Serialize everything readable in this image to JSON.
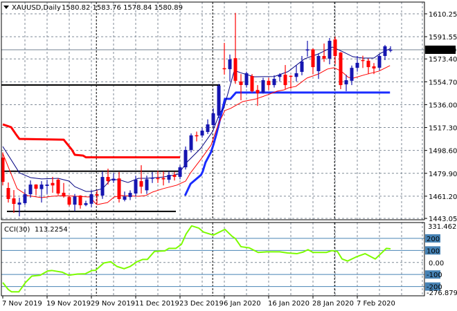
{
  "header": {
    "symbol_timeframe": "XAUUSD,Daily",
    "ohlc_text": "1580.82 1583.76 1578.84 1580.89",
    "menu_icon": "triangle-down-icon"
  },
  "colors": {
    "bull": "#1515b0",
    "bear": "#ff0000",
    "ma_fast": "#000080",
    "ma_slow": "#ff0000",
    "upper_step": "#ff0000",
    "lower_step": "#1a2cff",
    "levels": "#000000",
    "cci": "#7cfc00",
    "cci_levels": "#4682b4",
    "grid": "#7f8a96",
    "price_line": "#708090"
  },
  "chart_data": [
    {
      "type": "candlestick",
      "title": "XAUUSD,Daily",
      "ylim": [
        1443.05,
        1610.25
      ],
      "y_ticks": [
        "1610.25",
        "1591.55",
        "1573.40",
        "1554.70",
        "1536.00",
        "1517.30",
        "1498.60",
        "1479.90",
        "1461.20",
        "1443.05"
      ],
      "current_price": "1580.89",
      "x_labels": [
        "7 Nov 2019",
        "19 Nov 2019",
        "29 Nov 2019",
        "11 Dec 2019",
        "23 Dec 2019",
        "6 Jan 2020",
        "16 Jan 2020",
        "28 Jan 2020",
        "7 Feb 2020"
      ],
      "x_label_every_bars": 8,
      "candles_ohlc": [
        [
          1492.7,
          1497,
          1470,
          1472.9
        ],
        [
          1467.9,
          1472.4,
          1456.0,
          1458.9
        ],
        [
          1459.4,
          1466.2,
          1447.6,
          1454.9
        ],
        [
          1454.3,
          1460.0,
          1444.7,
          1456.0
        ],
        [
          1455.5,
          1466.8,
          1454,
          1462.8
        ],
        [
          1462.8,
          1474.1,
          1460.0,
          1470.7
        ],
        [
          1470.7,
          1471,
          1462,
          1467.3
        ],
        [
          1467,
          1473.5,
          1456,
          1470.7
        ],
        [
          1469.6,
          1474.6,
          1463,
          1470.7
        ],
        [
          1472,
          1477,
          1464,
          1470
        ],
        [
          1474.7,
          1476,
          1462,
          1463.4
        ],
        [
          1464,
          1472,
          1460,
          1461
        ],
        [
          1460.5,
          1461,
          1453,
          1454.3
        ],
        [
          1454.3,
          1463,
          1449,
          1461
        ],
        [
          1461.7,
          1462,
          1451,
          1453.8
        ],
        [
          1454,
          1457.5,
          1453,
          1455.5
        ],
        [
          1455,
          1466,
          1452,
          1462.8
        ],
        [
          1462.8,
          1466,
          1455,
          1461.7
        ],
        [
          1461.7,
          1481.5,
          1459,
          1476.9
        ],
        [
          1476.9,
          1483.7,
          1470.7,
          1473.5
        ],
        [
          1474,
          1480,
          1472,
          1475.5
        ],
        [
          1475.7,
          1480.9,
          1456,
          1458.9
        ],
        [
          1458.3,
          1465,
          1457,
          1461
        ],
        [
          1460.5,
          1466,
          1458,
          1463.9
        ],
        [
          1463.4,
          1478,
          1461,
          1474.7
        ],
        [
          1473.5,
          1486.5,
          1463.4,
          1469
        ],
        [
          1466,
          1478,
          1463,
          1475
        ],
        [
          1475.5,
          1481,
          1472,
          1476.3
        ],
        [
          1476,
          1482,
          1472,
          1475.5
        ],
        [
          1476,
          1481.5,
          1470,
          1475
        ],
        [
          1474.7,
          1481.5,
          1472,
          1478.6
        ],
        [
          1478.6,
          1481,
          1474,
          1477
        ],
        [
          1477,
          1486.5,
          1475,
          1484.8
        ],
        [
          1484.8,
          1501.8,
          1483,
          1499
        ],
        [
          1499,
          1512.5,
          1497,
          1510.9
        ],
        [
          1511,
          1514,
          1506,
          1510.8
        ],
        [
          1510.8,
          1517,
          1509,
          1514.8
        ],
        [
          1513.7,
          1524,
          1512,
          1519.9
        ],
        [
          1519.3,
          1533,
          1517,
          1528.9
        ],
        [
          1527,
          1553,
          1525,
          1551.5
        ],
        [
          1565.8,
          1586.5,
          1560.5,
          1565.1
        ],
        [
          1565,
          1577,
          1555,
          1573
        ],
        [
          1574,
          1611,
          1553,
          1555.5
        ],
        [
          1554.9,
          1561,
          1539.6,
          1552.1
        ],
        [
          1552,
          1563,
          1550,
          1561.7
        ],
        [
          1559.4,
          1561,
          1546,
          1547
        ],
        [
          1548,
          1552,
          1535,
          1545.3
        ],
        [
          1545.9,
          1558,
          1545,
          1556
        ],
        [
          1555.5,
          1558,
          1548,
          1552
        ],
        [
          1552,
          1560,
          1550,
          1557.1
        ],
        [
          1558.7,
          1561.6,
          1555,
          1560.5
        ],
        [
          1560.5,
          1568.4,
          1548.7,
          1552
        ],
        [
          1559.6,
          1560,
          1549,
          1559.4
        ],
        [
          1558.7,
          1568,
          1555,
          1561.7
        ],
        [
          1562.8,
          1575.8,
          1560,
          1571.3
        ],
        [
          1580.3,
          1588.2,
          1575.2,
          1581.2
        ],
        [
          1581.2,
          1582,
          1561,
          1566.7
        ],
        [
          1563.4,
          1578,
          1557,
          1575.8
        ],
        [
          1575.8,
          1586,
          1571,
          1573.6
        ],
        [
          1573.6,
          1590.5,
          1569,
          1588.2
        ],
        [
          1589.3,
          1591.6,
          1569,
          1575.8
        ],
        [
          1578.6,
          1579,
          1548.7,
          1552
        ],
        [
          1552.6,
          1560.5,
          1547,
          1556
        ],
        [
          1555.5,
          1568,
          1552,
          1566.1
        ],
        [
          1566.1,
          1575.8,
          1563,
          1570.2
        ],
        [
          1572.5,
          1576,
          1566,
          1571.9
        ],
        [
          1571.9,
          1573.6,
          1561,
          1566.7
        ],
        [
          1567.3,
          1570,
          1561,
          1565.6
        ],
        [
          1566.2,
          1577,
          1564,
          1575.8
        ],
        [
          1575.8,
          1584.8,
          1572.4,
          1583.7
        ],
        [
          1580.82,
          1583.76,
          1578.84,
          1580.89
        ]
      ],
      "overlays": {
        "ma_fast": [
          [
            0,
            1501.8
          ],
          [
            3,
            1480.3
          ],
          [
            5,
            1476.4
          ],
          [
            7,
            1475.3
          ],
          [
            10,
            1475.8
          ],
          [
            12,
            1473.5
          ],
          [
            13,
            1469
          ],
          [
            15,
            1465.1
          ],
          [
            16,
            1465.1
          ],
          [
            18,
            1467.3
          ],
          [
            19.5,
            1474.7
          ],
          [
            21,
            1474.7
          ],
          [
            22.6,
            1472.4
          ],
          [
            24.5,
            1475.8
          ],
          [
            26,
            1475.8
          ],
          [
            29,
            1476.9
          ],
          [
            31.7,
            1479.2
          ],
          [
            33.2,
            1488.8
          ],
          [
            35.7,
            1500.1
          ],
          [
            37.9,
            1514.2
          ],
          [
            39.2,
            1529.5
          ],
          [
            39.9,
            1533
          ],
          [
            41.8,
            1564
          ],
          [
            43,
            1562
          ],
          [
            45.4,
            1558.8
          ],
          [
            49,
            1559
          ],
          [
            51.5,
            1563
          ],
          [
            54.5,
            1573.5
          ],
          [
            57,
            1577.5
          ],
          [
            59.5,
            1583.1
          ],
          [
            61.4,
            1579.2
          ],
          [
            63.2,
            1575.2
          ],
          [
            65,
            1574.1
          ],
          [
            67,
            1574.1
          ],
          [
            68.2,
            1578
          ],
          [
            70,
            1582
          ]
        ],
        "ma_slow": [
          [
            0,
            1496.1
          ],
          [
            2.6,
            1467.3
          ],
          [
            4.5,
            1461.7
          ],
          [
            7,
            1460
          ],
          [
            8.9,
            1461.1
          ],
          [
            10.8,
            1461.7
          ],
          [
            13.2,
            1461.1
          ],
          [
            15.8,
            1460.5
          ],
          [
            16.6,
            1456
          ],
          [
            17,
            1454.3
          ],
          [
            18.9,
            1456
          ],
          [
            20.1,
            1460.5
          ],
          [
            21.4,
            1461.7
          ],
          [
            24.5,
            1461.1
          ],
          [
            25.8,
            1461.7
          ],
          [
            27,
            1464.5
          ],
          [
            28.9,
            1467.3
          ],
          [
            31.4,
            1470.2
          ],
          [
            33,
            1473.5
          ],
          [
            33.9,
            1480.3
          ],
          [
            35.8,
            1491.6
          ],
          [
            37.6,
            1502.9
          ],
          [
            38.9,
            1519.9
          ],
          [
            40.1,
            1531.2
          ],
          [
            41.1,
            1532.9
          ],
          [
            43.3,
            1538.5
          ],
          [
            45.8,
            1540.8
          ],
          [
            47.9,
            1544.2
          ],
          [
            49.5,
            1547
          ],
          [
            50.8,
            1548.1
          ],
          [
            51.6,
            1549.8
          ],
          [
            52.9,
            1550.9
          ],
          [
            54.9,
            1557.7
          ],
          [
            57,
            1561.1
          ],
          [
            58.6,
            1565.1
          ],
          [
            59.8,
            1566.2
          ],
          [
            61.1,
            1563.4
          ],
          [
            62.4,
            1558.3
          ],
          [
            63.3,
            1557.7
          ],
          [
            65.4,
            1560.5
          ],
          [
            67.9,
            1563.4
          ],
          [
            69.9,
            1567.9
          ]
        ],
        "upper_step": [
          [
            0,
            1519.9
          ],
          [
            1.5,
            1517.6
          ],
          [
            2.5,
            1511
          ],
          [
            3,
            1508
          ],
          [
            11,
            1507.4
          ],
          [
            12.5,
            1499
          ],
          [
            13,
            1495
          ],
          [
            14.5,
            1494.4
          ],
          [
            15,
            1493
          ],
          [
            32,
            1493
          ]
        ],
        "lower_step": [
          [
            32.9,
            1461.7
          ],
          [
            33.9,
            1471.3
          ],
          [
            35.8,
            1478.6
          ],
          [
            36.1,
            1481.4
          ],
          [
            36.6,
            1488.8
          ],
          [
            37.6,
            1497.3
          ],
          [
            38,
            1502.9
          ],
          [
            38.6,
            1512.5
          ],
          [
            39.3,
            1525.5
          ],
          [
            39.6,
            1531
          ],
          [
            40.1,
            1540.8
          ],
          [
            41.1,
            1540.8
          ],
          [
            42.1,
            1545.9
          ],
          [
            69.9,
            1545.9
          ]
        ],
        "horizontal_levels": [
          {
            "price": 1552.1,
            "from": 0,
            "to": 39
          },
          {
            "price": 1481.6,
            "from": 0,
            "to": 32
          },
          {
            "price": 1448.8,
            "from": 1,
            "to": 31
          }
        ]
      }
    },
    {
      "type": "line",
      "title": "CCI(30)",
      "value_text": "113.2254",
      "ylim": [
        -276.8793,
        331.462
      ],
      "y_ticks": {
        "max": "331.462",
        "min": "-276.8793",
        "zero": "0.00",
        "levels": [
          "200",
          "100",
          "-100",
          "-200"
        ]
      },
      "level_values": [
        200,
        100,
        -100,
        -200
      ],
      "series": [
        [
          0,
          -167
        ],
        [
          1,
          -225
        ],
        [
          1.6,
          -244
        ],
        [
          2.9,
          -244
        ],
        [
          4.1,
          -167
        ],
        [
          5.25,
          -113
        ],
        [
          6.75,
          -106
        ],
        [
          8.1,
          -71
        ],
        [
          8.9,
          -67
        ],
        [
          10.75,
          -81
        ],
        [
          11.9,
          -106
        ],
        [
          13.5,
          -96
        ],
        [
          14.9,
          -94
        ],
        [
          16.1,
          -67
        ],
        [
          16.75,
          -65
        ],
        [
          18.25,
          -4
        ],
        [
          19.5,
          6
        ],
        [
          20.6,
          -33
        ],
        [
          21.9,
          -52
        ],
        [
          23,
          -33
        ],
        [
          24.25,
          6
        ],
        [
          25.25,
          25
        ],
        [
          26.1,
          25
        ],
        [
          27.4,
          92
        ],
        [
          29.25,
          96
        ],
        [
          30,
          117
        ],
        [
          31.25,
          117
        ],
        [
          32.25,
          150
        ],
        [
          33.1,
          237
        ],
        [
          34.1,
          304
        ],
        [
          35.4,
          285
        ],
        [
          36.25,
          252
        ],
        [
          38,
          227
        ],
        [
          40.1,
          275
        ],
        [
          41.4,
          217
        ],
        [
          42,
          198
        ],
        [
          43,
          131
        ],
        [
          44.5,
          121
        ],
        [
          46.1,
          83
        ],
        [
          47.6,
          88
        ],
        [
          50,
          88
        ],
        [
          51.4,
          79
        ],
        [
          53.1,
          73
        ],
        [
          54.25,
          87
        ],
        [
          55.1,
          106
        ],
        [
          56,
          83
        ],
        [
          58.4,
          83
        ],
        [
          59.4,
          98
        ],
        [
          60.4,
          92
        ],
        [
          61.25,
          29
        ],
        [
          62.25,
          12
        ],
        [
          63.9,
          48
        ],
        [
          65.4,
          73
        ],
        [
          67.25,
          29
        ],
        [
          69.25,
          117
        ],
        [
          70,
          113.2
        ]
      ]
    }
  ]
}
